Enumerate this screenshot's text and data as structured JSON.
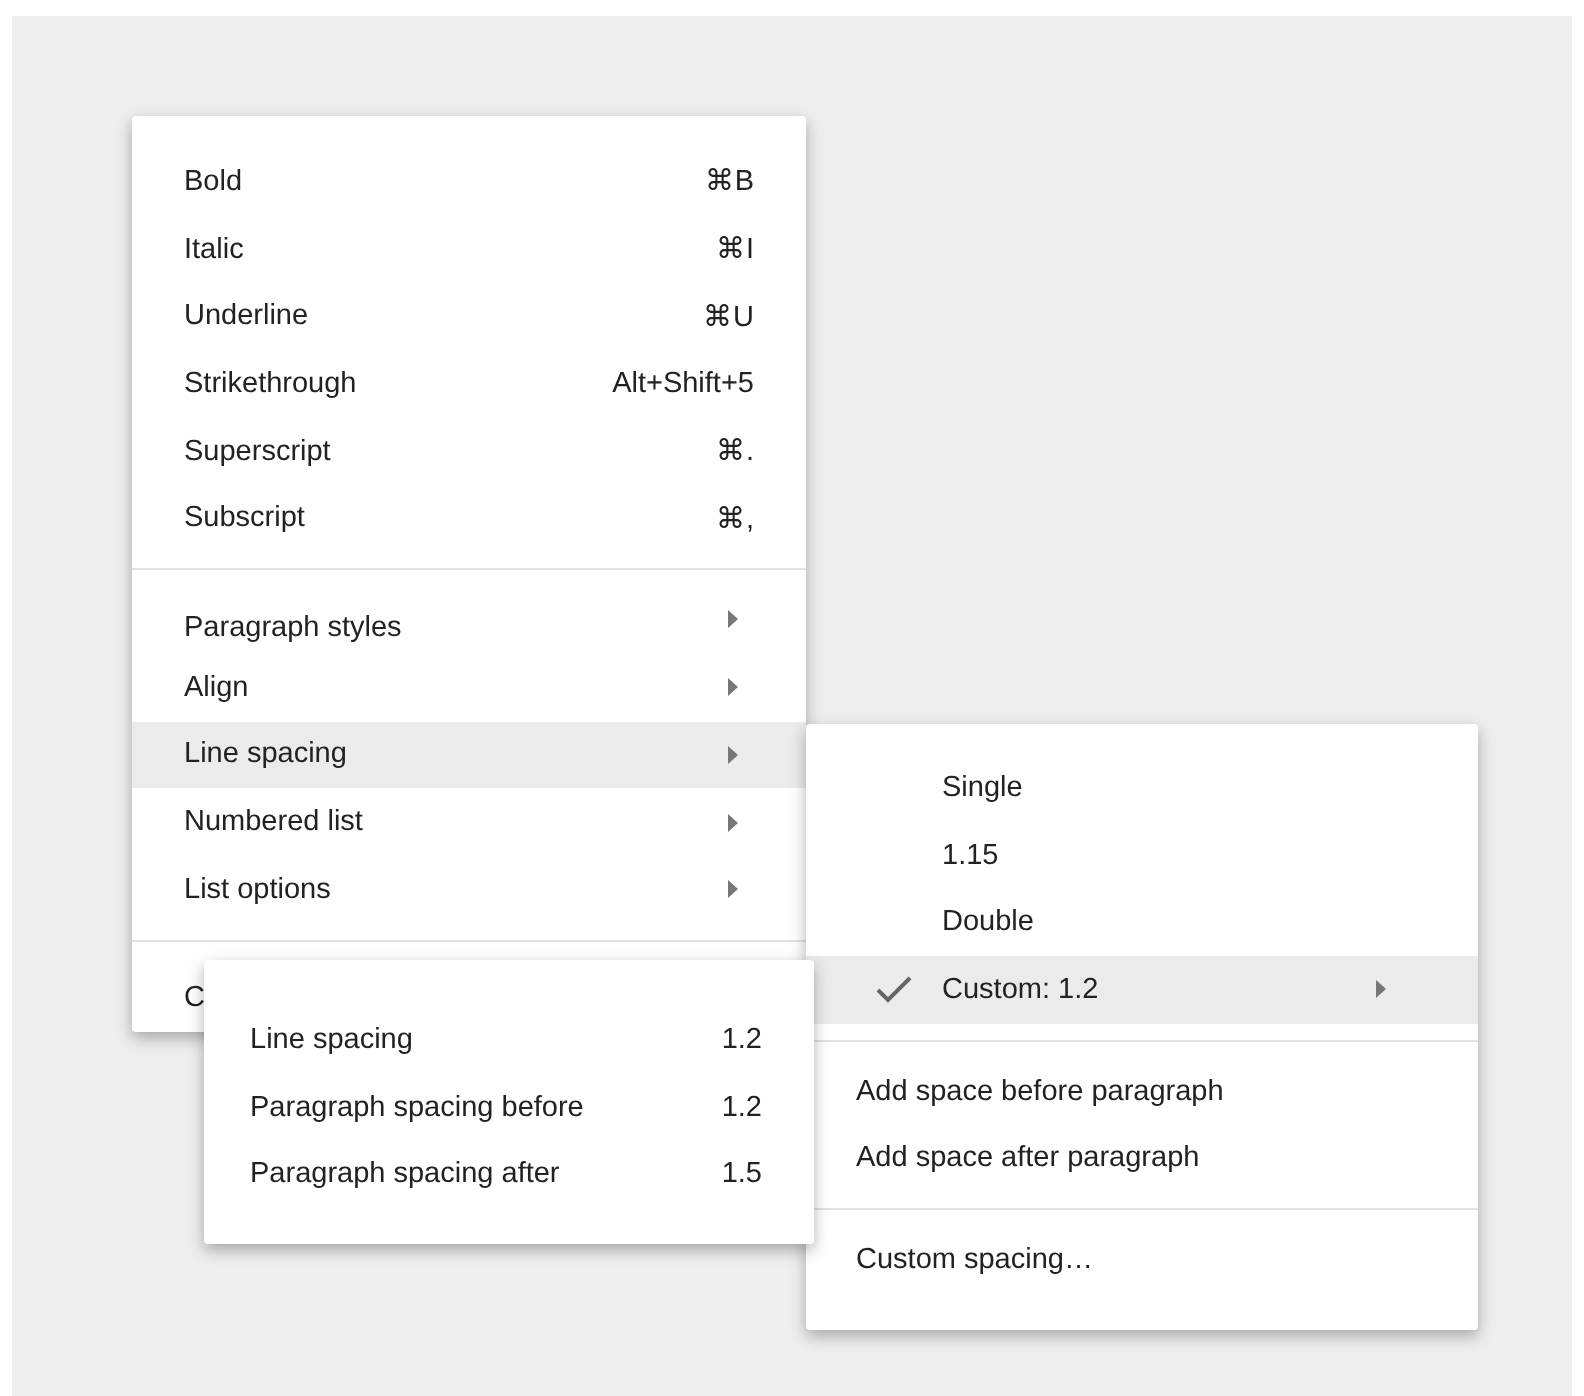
{
  "format_menu": {
    "groups": [
      [
        {
          "label": "Bold",
          "kind": "shortcut",
          "shortcut": "⌘B",
          "selected": false
        },
        {
          "label": "Italic",
          "kind": "shortcut",
          "shortcut": "⌘I",
          "selected": false
        },
        {
          "label": "Underline",
          "kind": "shortcut",
          "shortcut": "⌘U",
          "selected": false
        },
        {
          "label": "Strikethrough",
          "kind": "shortcut",
          "shortcut": "Alt+Shift+5",
          "selected": false
        },
        {
          "label": "Superscript",
          "kind": "shortcut",
          "shortcut": "⌘.",
          "selected": false
        },
        {
          "label": "Subscript",
          "kind": "shortcut",
          "shortcut": "⌘,",
          "selected": false
        }
      ],
      [
        {
          "label": "Paragraph styles",
          "kind": "submenu",
          "selected": false
        },
        {
          "label": "Align",
          "kind": "submenu",
          "selected": false
        },
        {
          "label": "Line spacing",
          "kind": "submenu",
          "selected": true
        },
        {
          "label": "Numbered list",
          "kind": "submenu",
          "selected": false
        },
        {
          "label": "List options",
          "kind": "submenu",
          "selected": false
        }
      ],
      [
        {
          "label": "C",
          "kind": "plain",
          "selected": false
        }
      ]
    ]
  },
  "line_spacing_menu": {
    "groups": [
      [
        {
          "label": "Single",
          "kind": "option",
          "checked": false,
          "selected": false
        },
        {
          "label": "1.15",
          "kind": "option",
          "checked": false,
          "selected": false
        },
        {
          "label": "Double",
          "kind": "option",
          "checked": false,
          "selected": false
        },
        {
          "label": "Custom: 1.2",
          "kind": "submenu",
          "checked": true,
          "selected": true
        }
      ],
      [
        {
          "label": "Add space before paragraph",
          "kind": "plain",
          "selected": false
        },
        {
          "label": "Add space after paragraph",
          "kind": "plain",
          "selected": false
        }
      ],
      [
        {
          "label": "Custom spacing…",
          "kind": "plain",
          "selected": false
        }
      ]
    ]
  },
  "custom_menu": {
    "rows": [
      {
        "label": "Line spacing",
        "value": "1.2"
      },
      {
        "label": "Paragraph spacing before",
        "value": "1.2"
      },
      {
        "label": "Paragraph spacing after",
        "value": "1.5"
      }
    ]
  }
}
